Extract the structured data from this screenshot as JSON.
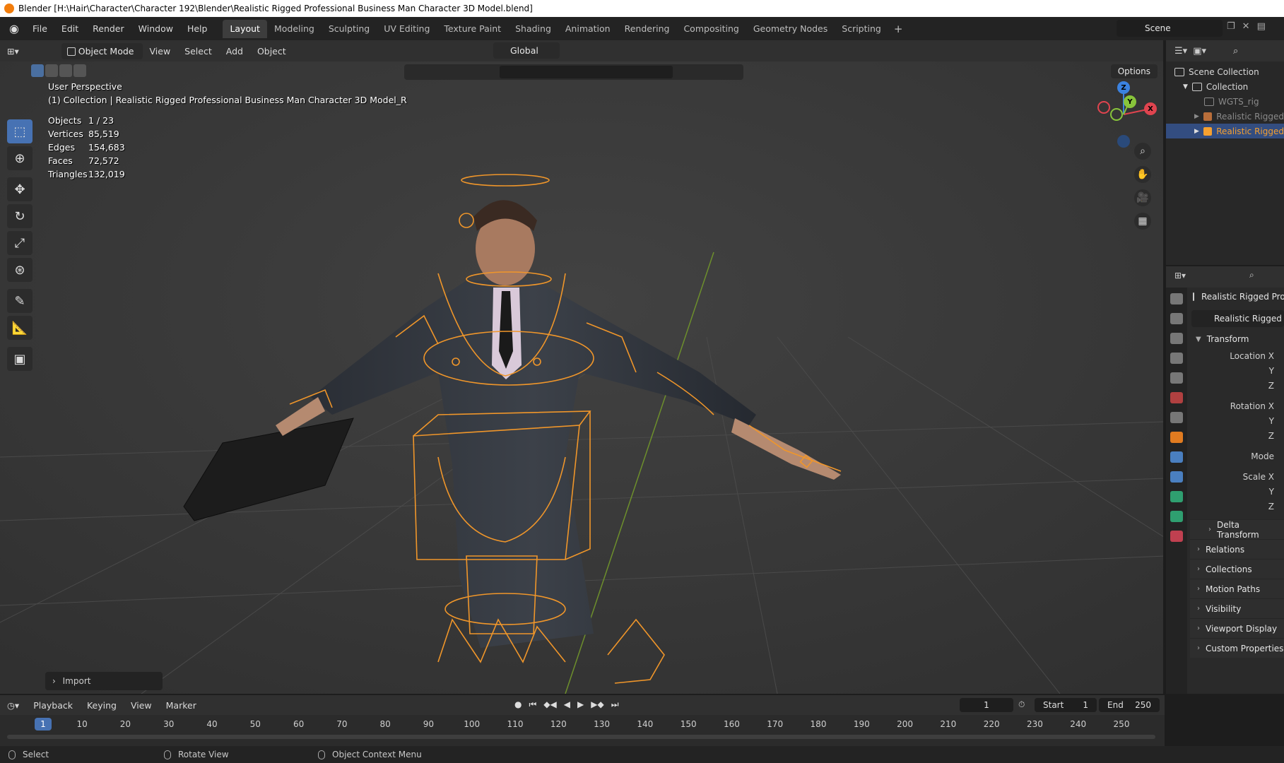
{
  "window": {
    "title": "Blender [H:\\Hair\\Character\\Character 192\\Blender\\Realistic Rigged Professional Business Man Character 3D Model.blend]"
  },
  "menubar": {
    "menus": [
      "File",
      "Edit",
      "Render",
      "Window",
      "Help"
    ],
    "workspaces": [
      "Layout",
      "Modeling",
      "Sculpting",
      "UV Editing",
      "Texture Paint",
      "Shading",
      "Animation",
      "Rendering",
      "Compositing",
      "Geometry Nodes",
      "Scripting"
    ],
    "active_workspace": "Layout",
    "add_label": "+",
    "scene": "Scene"
  },
  "viewport": {
    "mode": "Object Mode",
    "menus": [
      "View",
      "Select",
      "Add",
      "Object"
    ],
    "transform_orientation": "Global",
    "options_label": "Options",
    "perspective": "User Perspective",
    "collection_info": "(1) Collection | Realistic Rigged Professional Business Man Character 3D Model_R",
    "stats": [
      {
        "label": "Objects",
        "value": "1 / 23"
      },
      {
        "label": "Vertices",
        "value": "85,519"
      },
      {
        "label": "Edges",
        "value": "154,683"
      },
      {
        "label": "Faces",
        "value": "72,572"
      },
      {
        "label": "Triangles",
        "value": "132,019"
      }
    ],
    "gizmo": {
      "x": "X",
      "y": "Y",
      "z": "Z"
    },
    "last_operator": "Import"
  },
  "outliner": {
    "rows": [
      {
        "label": "Scene Collection"
      },
      {
        "label": "Collection"
      },
      {
        "label": "WGTS_rig"
      },
      {
        "label": "Realistic Rigged"
      },
      {
        "label": "Realistic Rigged"
      }
    ]
  },
  "properties": {
    "object_name": "Realistic Rigged Pro",
    "data_name": "Realistic Rigged I",
    "transform_title": "Transform",
    "location": {
      "x": "Location X",
      "y": "Y",
      "z": "Z"
    },
    "rotation": {
      "x": "Rotation X",
      "y": "Y",
      "z": "Z"
    },
    "mode_label": "Mode",
    "scale": {
      "x": "Scale X",
      "y": "Y",
      "z": "Z"
    },
    "sub_panels": [
      "Delta Transform",
      "Relations",
      "Collections",
      "Motion Paths",
      "Visibility",
      "Viewport Display",
      "Custom Properties"
    ]
  },
  "timeline": {
    "menus": [
      "Playback",
      "Keying",
      "View",
      "Marker"
    ],
    "current_frame": "1",
    "start_label": "Start",
    "start_value": "1",
    "end_label": "End",
    "end_value": "250",
    "ticks": [
      "10",
      "20",
      "30",
      "40",
      "50",
      "60",
      "70",
      "80",
      "90",
      "100",
      "110",
      "120",
      "130",
      "140",
      "150",
      "160",
      "170",
      "180",
      "190",
      "200",
      "210",
      "220",
      "230",
      "240",
      "250"
    ]
  },
  "statusbar": {
    "select": "Select",
    "rotate": "Rotate View",
    "context_menu": "Object Context Menu"
  },
  "colors": {
    "accent": "#4772b3",
    "selection": "#f5a030",
    "axis_x": "#e0444f",
    "axis_y": "#88c43b",
    "axis_z": "#3b82e0"
  }
}
